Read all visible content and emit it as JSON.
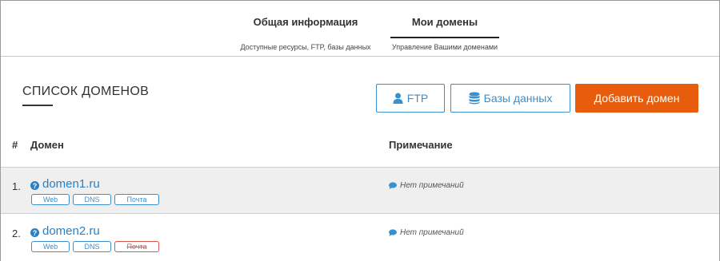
{
  "tabs": [
    {
      "title": "Общая информация",
      "subtitle": "Доступные ресурсы, FTP, базы данных",
      "active": false
    },
    {
      "title": "Мои домены",
      "subtitle": "Управление Вашими доменами",
      "active": true
    }
  ],
  "page": {
    "title": "СПИСОК ДОМЕНОВ"
  },
  "toolbar": {
    "ftp_label": "FTP",
    "ftp_icon": "user-icon",
    "db_label": "Базы данных",
    "db_icon": "database-icon",
    "add_label": "Добавить домен"
  },
  "table": {
    "headers": {
      "num": "#",
      "domain": "Домен",
      "note": "Примечание"
    },
    "rows": [
      {
        "num": "1.",
        "domain": "domen1.ru",
        "tags": [
          {
            "label": "Web",
            "enabled": true
          },
          {
            "label": "DNS",
            "enabled": true
          },
          {
            "label": "Почта",
            "enabled": true
          }
        ],
        "note": "Нет примечаний"
      },
      {
        "num": "2.",
        "domain": "domen2.ru",
        "tags": [
          {
            "label": "Web",
            "enabled": true
          },
          {
            "label": "DNS",
            "enabled": true
          },
          {
            "label": "Почта",
            "enabled": false
          }
        ],
        "note": "Нет примечаний"
      }
    ]
  },
  "colors": {
    "accent": "#3a8fcf",
    "link": "#2c7fc1",
    "primary_button": "#e85d0d",
    "disabled_tag": "#d9534f"
  }
}
